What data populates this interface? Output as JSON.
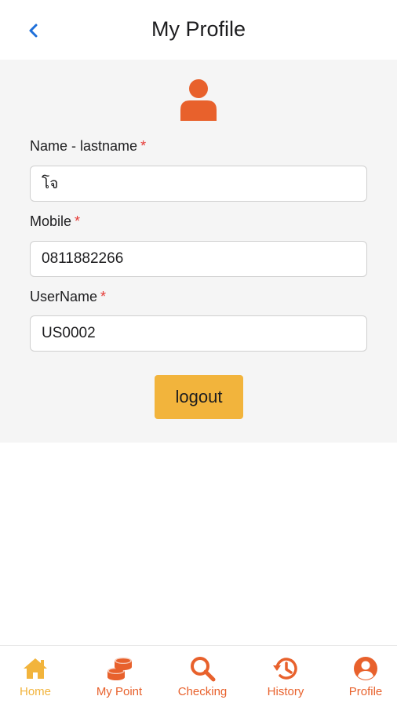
{
  "header": {
    "title": "My Profile",
    "back_icon": "chevron-left-icon"
  },
  "profile": {
    "avatar_icon": "user-icon",
    "fields": [
      {
        "label": "Name - lastname",
        "required_mark": "*",
        "value": "โจ"
      },
      {
        "label": "Mobile",
        "required_mark": "*",
        "value": "0811882266"
      },
      {
        "label": "UserName",
        "required_mark": "*",
        "value": "US0002"
      }
    ],
    "logout_label": "logout"
  },
  "tabbar": {
    "items": [
      {
        "label": "Home",
        "icon": "home-icon",
        "active": true
      },
      {
        "label": "My Point",
        "icon": "coins-icon",
        "active": false
      },
      {
        "label": "Checking",
        "icon": "search-icon",
        "active": false
      },
      {
        "label": "History",
        "icon": "history-icon",
        "active": false
      },
      {
        "label": "Profile",
        "icon": "profile-icon",
        "active": false
      }
    ]
  },
  "colors": {
    "accent": "#e8612c",
    "active_tab": "#f2b43c",
    "logout_button": "#f2b43c",
    "back_arrow": "#1e6fd9",
    "required": "#e53935",
    "content_bg": "#f5f5f5"
  }
}
